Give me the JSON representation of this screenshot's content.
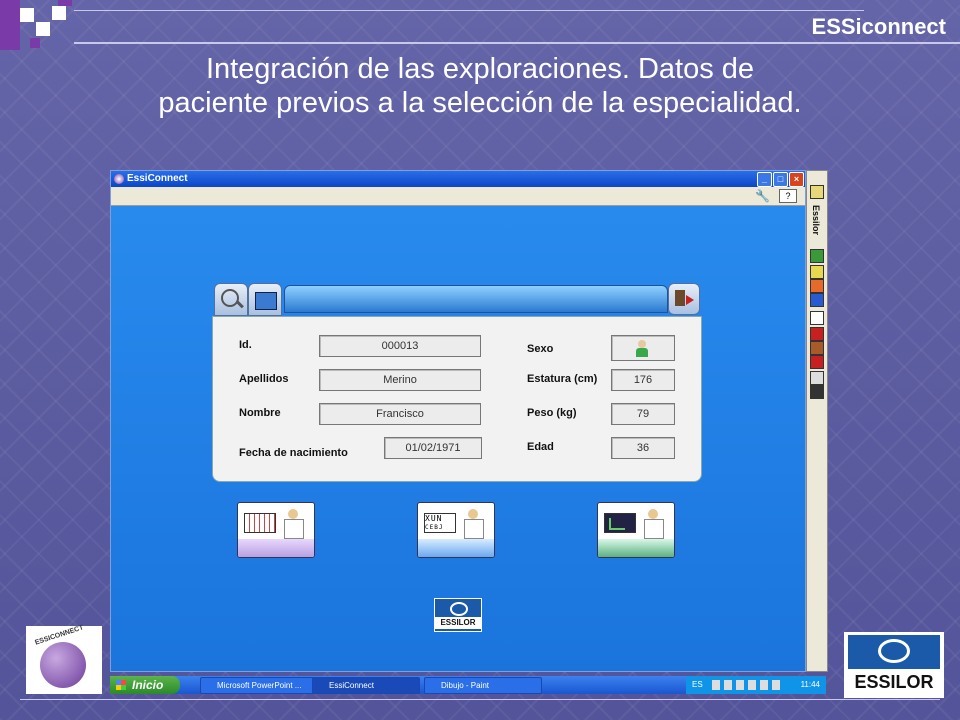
{
  "slide": {
    "brand": "ESSiconnect",
    "title_line1": "Integración de las exploraciones. Datos de",
    "title_line2": "paciente previos a la selección de la especialidad."
  },
  "window": {
    "title": "EssiConnect",
    "help_label": "?",
    "side_toolbar_label": "Essilor"
  },
  "patient": {
    "id_label": "Id.",
    "id_value": "000013",
    "apellidos_label": "Apellidos",
    "apellidos_value": "Merino",
    "nombre_label": "Nombre",
    "nombre_value": "Francisco",
    "fecha_label": "Fecha de nacimiento",
    "fecha_value": "01/02/1971",
    "sexo_label": "Sexo",
    "estatura_label": "Estatura (cm)",
    "estatura_value": "176",
    "peso_label": "Peso (kg)",
    "peso_value": "79",
    "edad_label": "Edad",
    "edad_value": "36"
  },
  "specialty_buttons": {
    "b2_row1": "XUN",
    "b2_row2": "CEBJ"
  },
  "taskbar": {
    "start_label": "Inicio",
    "tasks": [
      "Microsoft PowerPoint ...",
      "EssiConnect",
      "Dibujo - Paint"
    ],
    "lang": "ES",
    "clock": "11:44"
  },
  "logos": {
    "left_text": "ESSICONNECT",
    "right_text": "ESSILOR",
    "small_text": "ESSILOR"
  },
  "colors": {
    "slide_bg": "#5a5a9c",
    "window_bg": "#1c80e6",
    "accent_purple": "#b8a0e0",
    "accent_blue": "#6aa8f0",
    "accent_green": "#5ab080"
  }
}
